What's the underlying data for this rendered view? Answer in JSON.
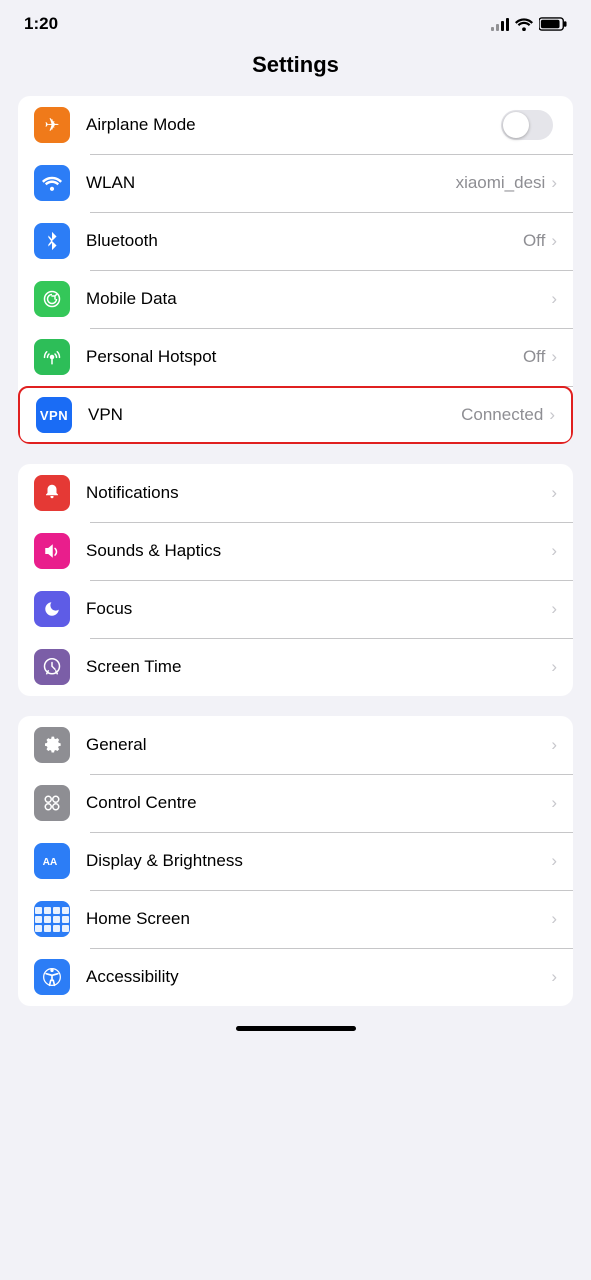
{
  "statusBar": {
    "time": "1:20"
  },
  "page": {
    "title": "Settings"
  },
  "groups": [
    {
      "id": "connectivity",
      "rows": [
        {
          "id": "airplane-mode",
          "label": "Airplane Mode",
          "value": "",
          "type": "toggle",
          "icon": "airplane",
          "iconColor": "orange"
        },
        {
          "id": "wlan",
          "label": "WLAN",
          "value": "xiaomi_desi",
          "type": "chevron",
          "icon": "wifi",
          "iconColor": "blue"
        },
        {
          "id": "bluetooth",
          "label": "Bluetooth",
          "value": "Off",
          "type": "chevron",
          "icon": "bluetooth",
          "iconColor": "blue"
        },
        {
          "id": "mobile-data",
          "label": "Mobile Data",
          "value": "",
          "type": "chevron",
          "icon": "signal",
          "iconColor": "green"
        },
        {
          "id": "personal-hotspot",
          "label": "Personal Hotspot",
          "value": "Off",
          "type": "chevron",
          "icon": "hotspot",
          "iconColor": "green-alt"
        },
        {
          "id": "vpn",
          "label": "VPN",
          "value": "Connected",
          "type": "chevron",
          "icon": "vpn",
          "iconColor": "blue-dark",
          "highlighted": true
        }
      ]
    },
    {
      "id": "notifications",
      "rows": [
        {
          "id": "notifications",
          "label": "Notifications",
          "value": "",
          "type": "chevron",
          "icon": "bell",
          "iconColor": "red"
        },
        {
          "id": "sounds-haptics",
          "label": "Sounds & Haptics",
          "value": "",
          "type": "chevron",
          "icon": "sound",
          "iconColor": "pink"
        },
        {
          "id": "focus",
          "label": "Focus",
          "value": "",
          "type": "chevron",
          "icon": "moon",
          "iconColor": "purple"
        },
        {
          "id": "screen-time",
          "label": "Screen Time",
          "value": "",
          "type": "chevron",
          "icon": "hourglass",
          "iconColor": "purple-alt"
        }
      ]
    },
    {
      "id": "general",
      "rows": [
        {
          "id": "general",
          "label": "General",
          "value": "",
          "type": "chevron",
          "icon": "gear",
          "iconColor": "gray"
        },
        {
          "id": "control-centre",
          "label": "Control Centre",
          "value": "",
          "type": "chevron",
          "icon": "controls",
          "iconColor": "gray"
        },
        {
          "id": "display-brightness",
          "label": "Display & Brightness",
          "value": "",
          "type": "chevron",
          "icon": "aa",
          "iconColor": "blue-aa"
        },
        {
          "id": "home-screen",
          "label": "Home Screen",
          "value": "",
          "type": "chevron",
          "icon": "grid",
          "iconColor": "blue-home"
        },
        {
          "id": "accessibility",
          "label": "Accessibility",
          "value": "",
          "type": "chevron",
          "icon": "accessibility",
          "iconColor": "blue-acc"
        }
      ]
    }
  ]
}
